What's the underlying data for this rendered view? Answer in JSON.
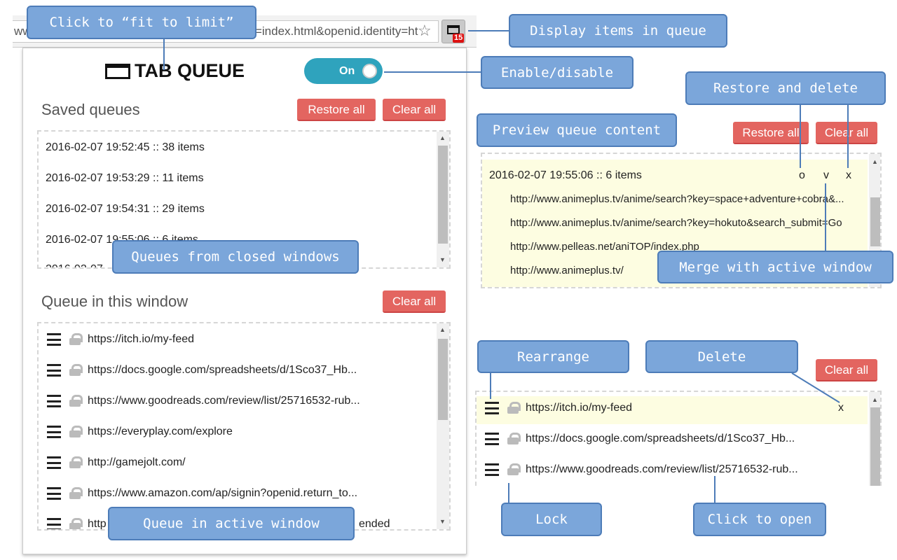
{
  "browser": {
    "address_text": "www.amazon.com/ap/signin?openid.return_to=index.html&openid.identity=ht",
    "extension_badge": "15"
  },
  "popup": {
    "title": "TAB QUEUE",
    "toggle_label": "On",
    "toggle_on": true,
    "accent_color": "#2fa3bd",
    "button_color": "#e36560",
    "saved": {
      "heading": "Saved queues",
      "restore_all": "Restore all",
      "clear_all": "Clear all",
      "items": [
        "2016-02-07 19:52:45 :: 38 items",
        "2016-02-07 19:53:29 :: 11 items",
        "2016-02-07 19:54:31 :: 29 items",
        "2016-02-07 19:55:06 :: 6 items",
        "2016-02-07"
      ]
    },
    "window_queue": {
      "heading": "Queue in this window",
      "clear_all": "Clear all",
      "items": [
        "https://itch.io/my-feed",
        "https://docs.google.com/spreadsheets/d/1Sco37_Hb...",
        "https://www.goodreads.com/review/list/25716532-rub...",
        "https://everyplay.com/explore",
        "http://gamejolt.com/",
        "https://www.amazon.com/ap/signin?openid.return_to...",
        "http",
        "ended"
      ]
    }
  },
  "preview": {
    "restore_all": "Restore all",
    "clear_all": "Clear all",
    "header": "2016-02-07 19:55:06 :: 6 items",
    "actions": {
      "restore": "o",
      "merge": "v",
      "delete": "x"
    },
    "urls": [
      "http://www.animeplus.tv/anime/search?key=space+adventure+cobra&...",
      "http://www.animeplus.tv/anime/search?key=hokuto&search_submit=Go",
      "http://www.pelleas.net/aniTOP/index.php",
      "http://www.animeplus.tv/"
    ]
  },
  "detail_list": {
    "clear_all": "Clear all",
    "delete": "x",
    "items": [
      "https://itch.io/my-feed",
      "https://docs.google.com/spreadsheets/d/1Sco37_Hb...",
      "https://www.goodreads.com/review/list/25716532-rub..."
    ]
  },
  "callouts": {
    "fit": "Click to “fit to limit”",
    "display": "Display items in queue",
    "enable": "Enable/disable",
    "restore_delete": "Restore and delete",
    "preview": "Preview queue content",
    "merge": "Merge with active window",
    "closed": "Queues from closed windows",
    "active": "Queue in active window",
    "rearrange": "Rearrange",
    "delete": "Delete",
    "lock": "Lock",
    "open": "Click to open"
  }
}
